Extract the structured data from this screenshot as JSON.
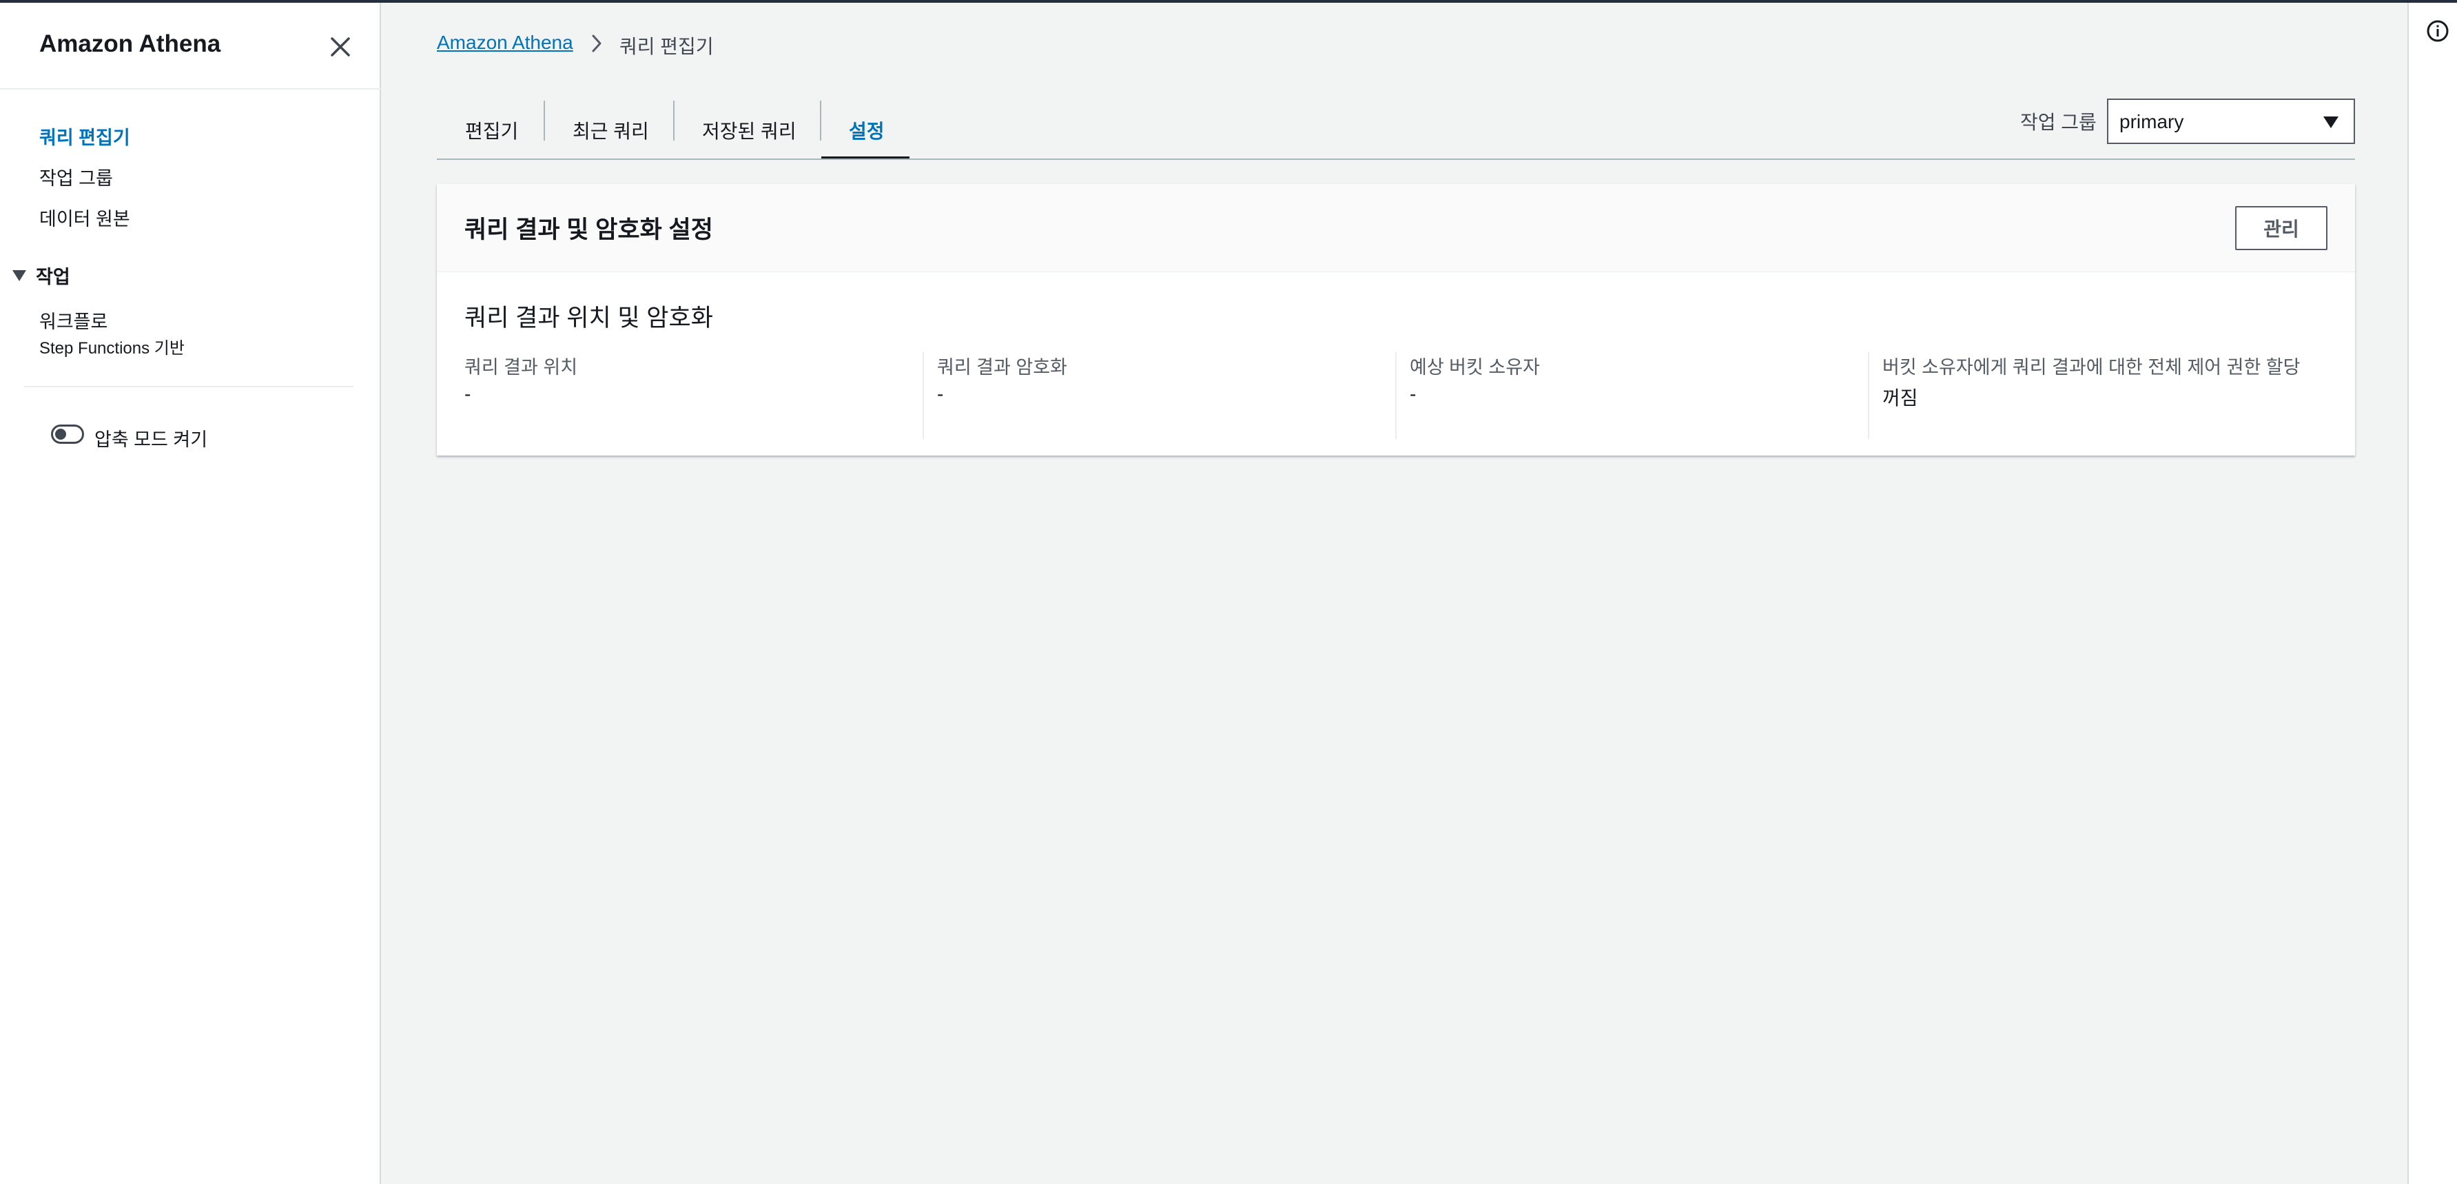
{
  "sidebar": {
    "title": "Amazon Athena",
    "items": [
      {
        "label": "쿼리 편집기",
        "active": true
      },
      {
        "label": "작업 그룹",
        "active": false
      },
      {
        "label": "데이터 원본",
        "active": false
      }
    ],
    "section": {
      "label": "작업",
      "items": [
        {
          "label": "워크플로",
          "sublabel": "Step Functions 기반"
        }
      ]
    },
    "toggle_label": "압축 모드 켜기"
  },
  "breadcrumb": {
    "root": "Amazon Athena",
    "current": "쿼리 편집기"
  },
  "tabs": [
    {
      "label": "편집기"
    },
    {
      "label": "최근 쿼리"
    },
    {
      "label": "저장된 쿼리"
    },
    {
      "label": "설정",
      "active": true
    }
  ],
  "workgroup": {
    "label": "작업 그룹",
    "value": "primary"
  },
  "panel": {
    "title": "쿼리 결과 및 암호화 설정",
    "manage_label": "관리",
    "subtitle": "쿼리 결과 위치 및 암호화",
    "fields": [
      {
        "label": "쿼리 결과 위치",
        "value": "-"
      },
      {
        "label": "쿼리 결과 암호화",
        "value": "-"
      },
      {
        "label": "예상 버킷 소유자",
        "value": "-"
      },
      {
        "label": "버킷 소유자에게 쿼리 결과에 대한 전체 제어 권한 할당",
        "value": "꺼짐"
      }
    ]
  },
  "colors": {
    "link": "#0073bb",
    "text": "#16191f",
    "page_bg": "#f2f3f3",
    "nav_border": "#232f3e"
  },
  "icons": {
    "close": "close-icon",
    "breadcrumb_separator": "chevron-right-icon",
    "section_toggle": "caret-down-icon",
    "dropdown": "caret-down-icon",
    "info": "info-icon"
  }
}
